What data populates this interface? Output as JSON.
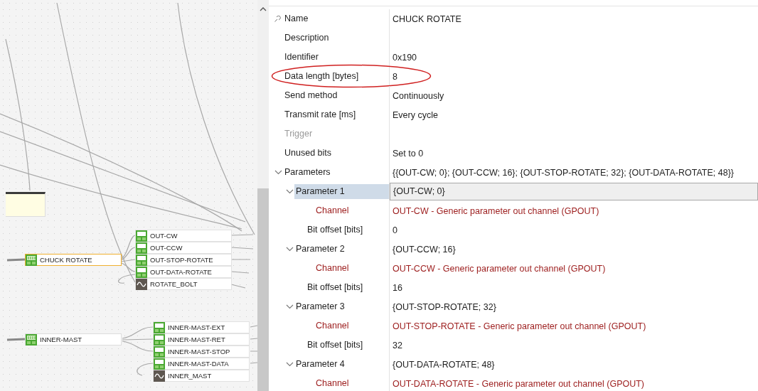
{
  "canvas": {
    "nodes": [
      {
        "label": "CHUCK ROTATE",
        "selected": true,
        "outputs": [
          {
            "label": "OUT-CW",
            "kind": "channel"
          },
          {
            "label": "OUT-CCW",
            "kind": "channel"
          },
          {
            "label": "OUT-STOP-ROTATE",
            "kind": "channel"
          },
          {
            "label": "OUT-DATA-ROTATE",
            "kind": "channel"
          },
          {
            "label": "ROTATE_BOLT",
            "kind": "signal"
          }
        ]
      },
      {
        "label": "INNER-MAST",
        "selected": false,
        "outputs": [
          {
            "label": "INNER-MAST-EXT",
            "kind": "channel"
          },
          {
            "label": "INNER-MAST-RET",
            "kind": "channel"
          },
          {
            "label": "INNER-MAST-STOP",
            "kind": "channel"
          },
          {
            "label": "INNER-MAST-DATA",
            "kind": "channel"
          },
          {
            "label": "INNER_MAST",
            "kind": "signal"
          }
        ]
      }
    ]
  },
  "properties": [
    {
      "label": "Name",
      "value": "CHUCK ROTATE",
      "kind": "text",
      "selected": false,
      "disabled": false
    },
    {
      "label": "Description",
      "kind": "text",
      "selected": false,
      "disabled": false
    },
    {
      "label": "Identifier",
      "value": "0x190",
      "kind": "text",
      "selected": false,
      "disabled": false
    },
    {
      "label": "Data length [bytes]",
      "value": "8",
      "kind": "text",
      "selected": false,
      "disabled": false,
      "circled": true
    },
    {
      "label": "Send method",
      "value": "Continuously",
      "kind": "text",
      "selected": false,
      "disabled": false
    },
    {
      "label": "Transmit rate [ms]",
      "value": "Every cycle",
      "kind": "text",
      "selected": false,
      "disabled": false
    },
    {
      "label": "Trigger",
      "kind": "text",
      "selected": false,
      "disabled": true
    },
    {
      "label": "Unused bits",
      "value": "Set to 0",
      "kind": "text",
      "selected": false,
      "disabled": false
    },
    {
      "label": "Parameters",
      "value": "{{OUT-CW; 0}; {OUT-CCW; 16}; {OUT-STOP-ROTATE; 32}; {OUT-DATA-ROTATE; 48}}",
      "kind": "text",
      "selected": false,
      "disabled": false,
      "expanded": true,
      "children": [
        {
          "label": "Parameter 1",
          "value": "{OUT-CW; 0}",
          "kind": "text",
          "selected": true,
          "disabled": false,
          "expanded": true,
          "children": [
            {
              "label": "Channel",
              "value": "OUT-CW - Generic parameter out channel (GPOUT)",
              "kind": "reference",
              "selected": false,
              "disabled": false
            },
            {
              "label": "Bit offset [bits]",
              "value": "0",
              "kind": "text",
              "selected": false,
              "disabled": false
            }
          ]
        },
        {
          "label": "Parameter 2",
          "value": "{OUT-CCW; 16}",
          "kind": "text",
          "selected": false,
          "disabled": false,
          "expanded": true,
          "children": [
            {
              "label": "Channel",
              "value": "OUT-CCW - Generic parameter out channel (GPOUT)",
              "kind": "reference",
              "selected": false,
              "disabled": false
            },
            {
              "label": "Bit offset [bits]",
              "value": "16",
              "kind": "text",
              "selected": false,
              "disabled": false
            }
          ]
        },
        {
          "label": "Parameter 3",
          "value": "{OUT-STOP-ROTATE; 32}",
          "kind": "text",
          "selected": false,
          "disabled": false,
          "expanded": true,
          "children": [
            {
              "label": "Channel",
              "value": "OUT-STOP-ROTATE - Generic parameter out channel (GPOUT)",
              "kind": "reference",
              "selected": false,
              "disabled": false
            },
            {
              "label": "Bit offset [bits]",
              "value": "32",
              "kind": "text",
              "selected": false,
              "disabled": false
            }
          ]
        },
        {
          "label": "Parameter 4",
          "value": "{OUT-DATA-ROTATE; 48}",
          "kind": "text",
          "selected": false,
          "disabled": false,
          "expanded": true,
          "children": [
            {
              "label": "Channel",
              "value": "OUT-DATA-ROTATE - Generic parameter out channel (GPOUT)",
              "kind": "reference",
              "selected": false,
              "disabled": false
            }
          ]
        }
      ]
    }
  ]
}
